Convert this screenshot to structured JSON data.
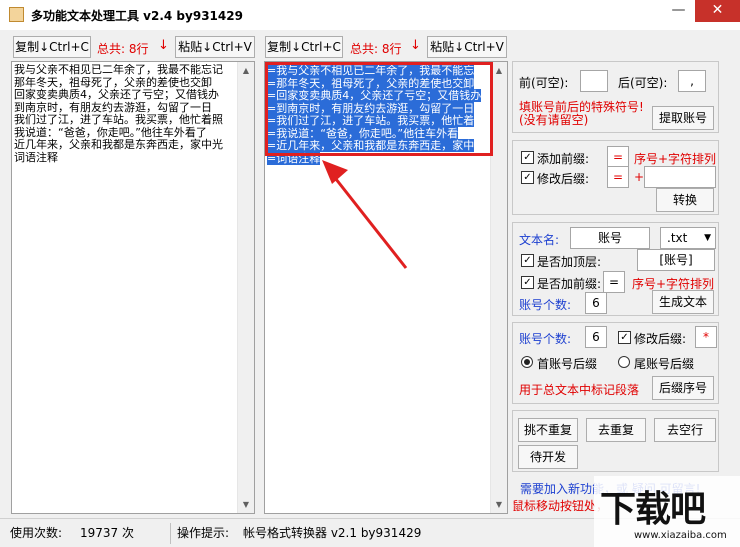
{
  "window": {
    "title": "多功能文本处理工具 v2.4 by931429",
    "minimize": "—",
    "close": "✕"
  },
  "left_pane": {
    "copy_label": "复制↓Ctrl+C",
    "total_label": "总共: 8行",
    "arrow": "↓",
    "paste_label": "粘贴↓Ctrl+V",
    "lines": [
      "我与父亲不相见已二年余了，我最不能忘记",
      "那年冬天，祖母死了，父亲的差使也交卸",
      "回家变卖典质4，父亲还了亏空；又借钱办",
      "到南京时，有朋友约去游逛，勾留了一日",
      "我们过了江，进了车站。我买票，他忙着照",
      "我说道：“爸爸，你走吧。”他往车外看了",
      "近几年来，父亲和我都是东奔西走，家中光",
      "词语注释"
    ]
  },
  "right_pane": {
    "copy_label": "复制↓Ctrl+C",
    "total_label": "总共: 8行",
    "arrow": "↓",
    "paste_label": "粘贴↓Ctrl+V",
    "lines": [
      "=我与父亲不相见已二年余了，我最不能忘",
      "=那年冬天，祖母死了，父亲的差使也交卸",
      "=回家变卖典质4，父亲还了亏空；又借钱办",
      "=到南京时，有朋友约去游逛，勾留了一日",
      "=我们过了江，进了车站。我买票，他忙着",
      "=我说道：“爸爸，你走吧。”他往车外看",
      "=近几年来，父亲和我都是东奔西走，家中",
      "=词语注释"
    ]
  },
  "account_section": {
    "prefix_label": "前(可空):",
    "prefix_value": "",
    "suffix_label": "后(可空):",
    "suffix_value": ",",
    "hint1": "填账号前后的特殊符号!",
    "hint2": "(没有请留空)",
    "extract_button": "提取账号"
  },
  "affix_section": {
    "add_prefix_label": "添加前缀:",
    "add_prefix_value": "=",
    "prefix_hint": "序号+字符排列",
    "modify_suffix_label": "修改后缀:",
    "modify_suffix_value": "=",
    "plus": "+",
    "suffix_value": "",
    "convert_button": "转换"
  },
  "file_section": {
    "filename_label": "文本名:",
    "filename_value": "账号",
    "ext_value": ".txt",
    "add_top_label": "是否加顶层:",
    "top_value": "[账号]",
    "add_prefix_label": "是否加前缀:",
    "prefix_value": "=",
    "prefix_hint": "序号+字符排列",
    "count_label": "账号个数:",
    "count_value": "6",
    "generate_button": "生成文本"
  },
  "suffix_section": {
    "count_label": "账号个数:",
    "count_value": "6",
    "modify_suffix_label": "修改后缀:",
    "modify_suffix_value": "*",
    "first_suffix_label": "首账号后缀",
    "last_suffix_label": "尾账号后缀",
    "hint": "用于总文本中标记段落",
    "suffix_seq_button": "后缀序号"
  },
  "actions": {
    "pick_unique": "挑不重复",
    "remove_dup": "去重复",
    "remove_blank": "去空行",
    "pending": "待开发"
  },
  "footer_notes": {
    "blue_note": "需要加入新功能，或 疑问 可留言!",
    "red_note": "鼠标移动按钮处，"
  },
  "status": {
    "usage_label": "使用次数:",
    "usage_value": "19737 次",
    "tip_label": "操作提示:",
    "tip_value": "帐号格式转换器 v2.1 by931429"
  },
  "watermark": {
    "mark": "下载吧",
    "url": "www.xiazaiba.com"
  },
  "colors": {
    "highlight": "#2b6cd8",
    "annotation_red": "#e02020",
    "hint_red": "#e00000",
    "label_blue": "#1c3fd0"
  }
}
